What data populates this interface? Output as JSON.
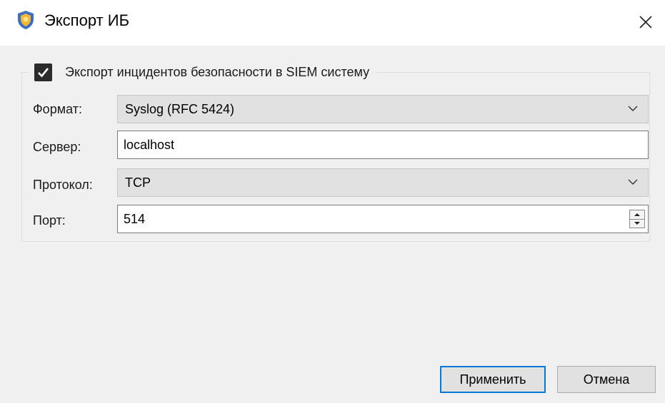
{
  "window": {
    "title": "Экспорт ИБ",
    "icon": "shield-app-icon",
    "close_icon": "close-icon"
  },
  "group": {
    "checkbox_checked": true,
    "label": "Экспорт инцидентов безопасности в SIEM систему"
  },
  "fields": {
    "format": {
      "label": "Формат:",
      "value": "Syslog (RFC 5424)"
    },
    "server": {
      "label": "Сервер:",
      "value": "localhost"
    },
    "protocol": {
      "label": "Протокол:",
      "value": "TCP"
    },
    "port": {
      "label": "Порт:",
      "value": "514"
    }
  },
  "buttons": {
    "apply": "Применить",
    "cancel": "Отмена"
  },
  "colors": {
    "accent": "#0078d7",
    "window_bg": "#f0f0f0",
    "shield_outer": "#3a6fc4",
    "shield_inner": "#f4b731"
  }
}
